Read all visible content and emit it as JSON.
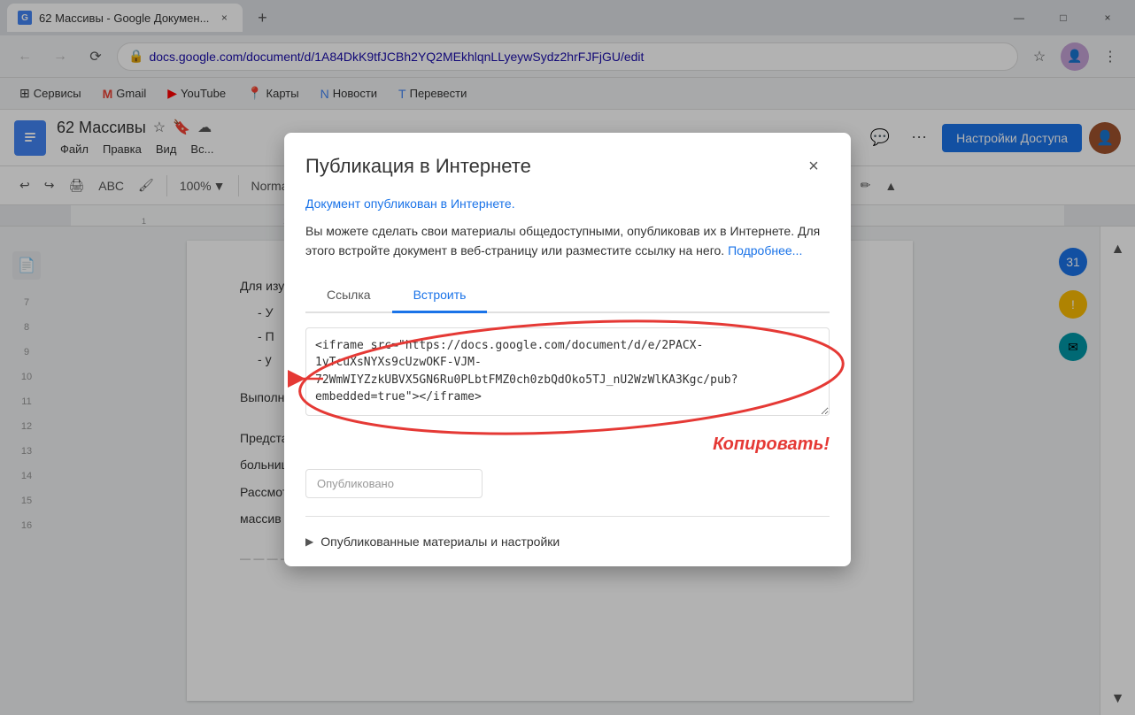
{
  "browser": {
    "tab_title": "62 Массивы - Google Докумен...",
    "tab_close": "×",
    "new_tab": "+",
    "url": "docs.google.com/document/d/1A84DkK9tfJCBh2YQ2MEkhlqnLLyeywSydz2hrFJFjGU/edit",
    "window_controls": {
      "minimize": "—",
      "maximize": "□",
      "close": "×"
    }
  },
  "bookmarks": [
    {
      "label": "Сервисы",
      "icon": "⊞"
    },
    {
      "label": "Gmail",
      "icon": "M"
    },
    {
      "label": "YouTube",
      "icon": "▶"
    },
    {
      "label": "Карты",
      "icon": "📍"
    },
    {
      "label": "Новости",
      "icon": "N"
    },
    {
      "label": "Перевести",
      "icon": "T"
    }
  ],
  "docs": {
    "title": "62 Массивы",
    "menu": [
      "Файл",
      "Правка",
      "Вид",
      "Вс..."
    ],
    "share_btn": "Настройки Доступа",
    "toolbar": {
      "undo": "↩",
      "redo": "↪",
      "print": "🖨",
      "format_paint": "🖌",
      "zoom": "100%",
      "zoom_arrow": "▼"
    }
  },
  "dialog": {
    "title": "Публикация в Интернете",
    "close": "×",
    "published_link": "Документ опубликован в Интернете.",
    "description": "Вы можете сделать свои материалы общедоступными, опубликовав их в Интернете. Для этого встройте документ в веб-страницу или разместите ссылку на него.",
    "learn_more": "Подробнее...",
    "tabs": [
      {
        "label": "Ссылка",
        "active": false
      },
      {
        "label": "Встроить",
        "active": true
      }
    ],
    "embed_code": "<iframe src=\"https://docs.google.com/document/d/e/2PACX-1vTcuXsNYXs9cUzwOKF-VJM-72WmWIYZzkUBVX5GN6Ru0PLbtFMZ0ch0zbQdOko5TJ_nU2WzWlKA3Kgc/pub?embedded=true\"></iframe>",
    "copy_label": "Копировать!",
    "published_dropdown_placeholder": "Опубликовано",
    "published_section": "Опубликованные материалы и настройки"
  },
  "doc_content": {
    "heading": "Для изуч",
    "bullets": [
      "У",
      "П",
      "у"
    ],
    "section": "Выполн",
    "paragraph1": "Предста",
    "paragraph2": "больниц",
    "paragraph3": "Рассмот",
    "paragraph4": "массив с"
  }
}
